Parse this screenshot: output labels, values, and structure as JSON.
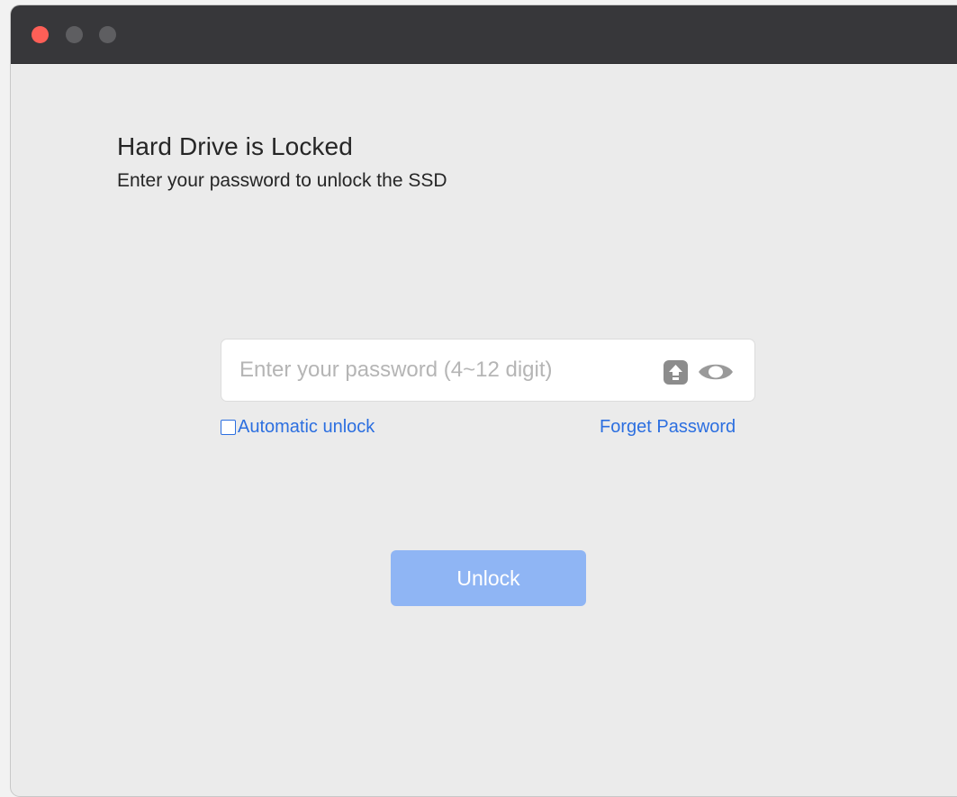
{
  "window": {
    "controls": [
      {
        "name": "close",
        "color": "#fe5f57"
      },
      {
        "name": "minimize",
        "color": "#5e5e61"
      },
      {
        "name": "maximize",
        "color": "#5e5e61"
      }
    ]
  },
  "header": {
    "title": "Hard Drive is Locked",
    "subtitle": "Enter your password to unlock the SSD"
  },
  "password": {
    "value": "",
    "placeholder": "Enter your password (4~12 digit)",
    "icons": [
      "caps-lock-icon",
      "eye-icon"
    ]
  },
  "options": {
    "auto_unlock_label": "Automatic unlock",
    "auto_unlock_checked": false,
    "forget_password_label": "Forget Password"
  },
  "actions": {
    "unlock_label": "Unlock",
    "unlock_enabled": false
  },
  "colors": {
    "accent": "#2c6fe0",
    "button_disabled": "#8fb5f4",
    "titlebar": "#37373a",
    "background": "#ebebeb"
  }
}
